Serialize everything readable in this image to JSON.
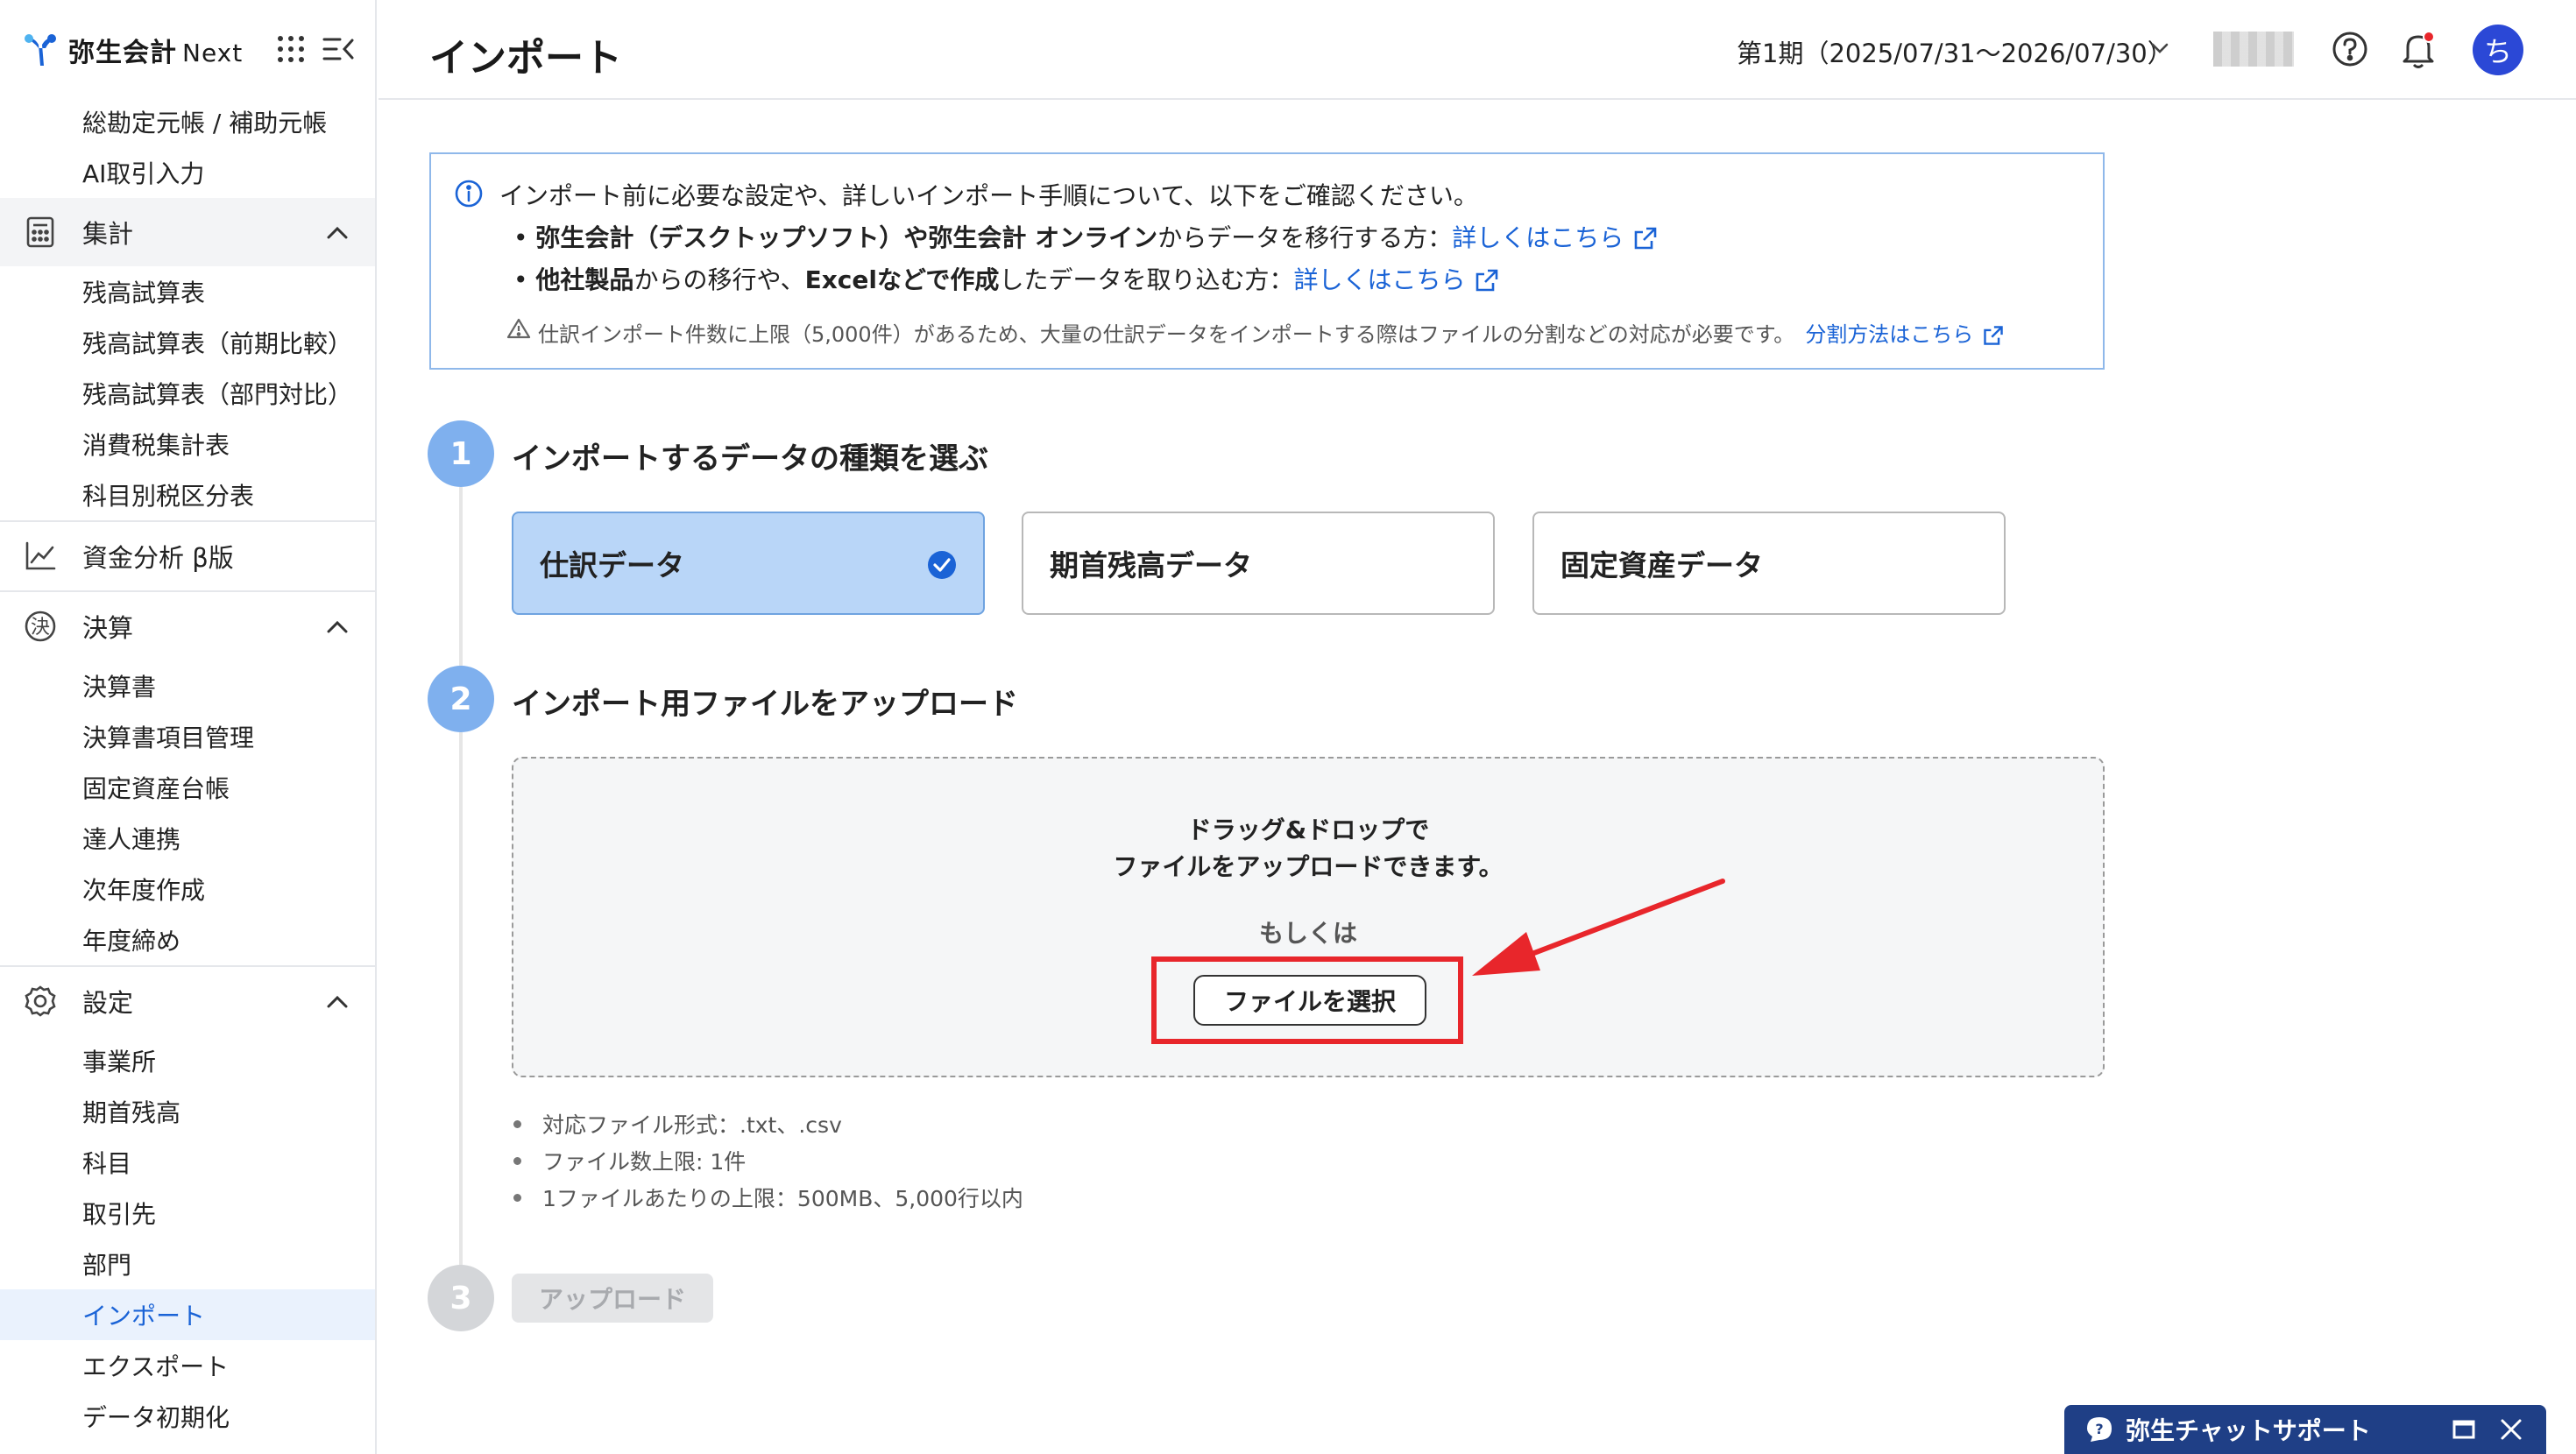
{
  "brand": {
    "name": "弥生会計",
    "suffix": "Next"
  },
  "header": {
    "title": "インポート",
    "period": "第1期（2025/07/31〜2026/07/30）",
    "avatar_initial": "ち"
  },
  "sidebar": {
    "top_items": [
      {
        "label": "総勘定元帳 / 補助元帳"
      },
      {
        "label": "AI取引入力"
      }
    ],
    "group_aggregate": {
      "label": "集計"
    },
    "aggregate_items": [
      {
        "label": "残高試算表"
      },
      {
        "label": "残高試算表（前期比較）"
      },
      {
        "label": "残高試算表（部門対比）"
      },
      {
        "label": "消費税集計表"
      },
      {
        "label": "科目別税区分表"
      }
    ],
    "group_funds": {
      "label": "資金分析 β版"
    },
    "group_closing": {
      "label": "決算"
    },
    "closing_items": [
      {
        "label": "決算書"
      },
      {
        "label": "決算書項目管理"
      },
      {
        "label": "固定資産台帳"
      },
      {
        "label": "達人連携"
      },
      {
        "label": "次年度作成"
      },
      {
        "label": "年度締め"
      }
    ],
    "group_settings": {
      "label": "設定"
    },
    "settings_items": [
      {
        "label": "事業所"
      },
      {
        "label": "期首残高"
      },
      {
        "label": "科目"
      },
      {
        "label": "取引先"
      },
      {
        "label": "部門"
      },
      {
        "label": "インポート"
      },
      {
        "label": "エクスポート"
      },
      {
        "label": "データ初期化"
      }
    ]
  },
  "info": {
    "intro": "インポート前に必要な設定や、詳しいインポート手順について、以下をご確認ください。",
    "b1_bold1": "弥生会計（デスクトップソフト）や弥生会計 オンライン",
    "b1_rest": "からデータを移行する方：",
    "b1_link": "詳しくはこちら",
    "b2_bold1": "他社製品",
    "b2_mid1": "からの移行や、",
    "b2_bold2": "Excelなどで作成",
    "b2_mid2": "したデータを取り込む方：",
    "b2_link": "詳しくはこちら",
    "note": "仕訳インポート件数に上限（5,000件）があるため、大量の仕訳データをインポートする際はファイルの分割などの対応が必要です。",
    "note_link": "分割方法はこちら"
  },
  "step1": {
    "number": "1",
    "title": "インポートするデータの種類を選ぶ",
    "options": [
      {
        "label": "仕訳データ"
      },
      {
        "label": "期首残高データ"
      },
      {
        "label": "固定資産データ"
      }
    ]
  },
  "step2": {
    "number": "2",
    "title": "インポート用ファイルをアップロード",
    "drop_line1": "ドラッグ&ドロップで",
    "drop_line2": "ファイルをアップロードできます。",
    "or": "もしくは",
    "select_button": "ファイルを選択",
    "specs": [
      "対応ファイル形式：.txt、.csv",
      "ファイル数上限: 1件",
      "1ファイルあたりの上限：500MB、5,000行以内"
    ]
  },
  "step3": {
    "number": "3",
    "button": "アップロード"
  },
  "chat": {
    "label": "弥生チャットサポート"
  },
  "colors": {
    "accent": "#1a63d6",
    "step_active": "#7fb0ee",
    "step_inactive": "#d4d6d9",
    "highlight": "#e8262b",
    "chat_bg": "#1f3f86"
  }
}
